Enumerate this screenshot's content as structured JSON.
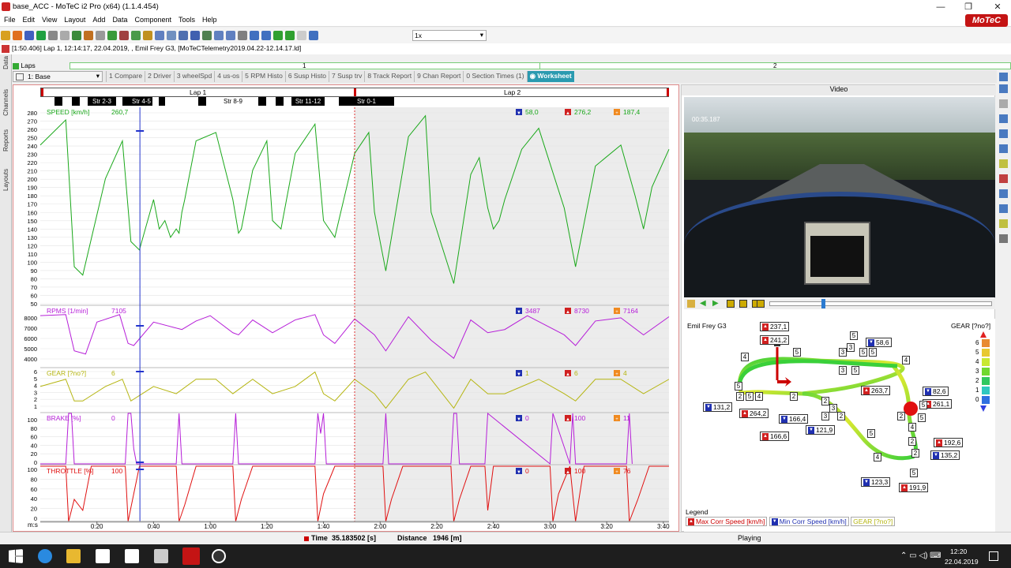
{
  "window": {
    "title": "base_ACC - MoTeC i2 Pro (x64) (1.1.4.454)",
    "logo": "MoTeC"
  },
  "menu": [
    "File",
    "Edit",
    "View",
    "Layout",
    "Add",
    "Data",
    "Component",
    "Tools",
    "Help"
  ],
  "toolbar": {
    "zoom_value": "1x"
  },
  "info": {
    "text": "[1:50.406] Lap 1, 12:14:17, 22.04.2019, , Emil Frey G3, [MoTeCTelemetry2019.04.22-12.14.17.ld]"
  },
  "laps": {
    "label": "Laps",
    "lap1": "1",
    "lap2": "2"
  },
  "sidebar": {
    "data": "Data",
    "channels": "Channels",
    "reports": "Reports",
    "layouts": "Layouts"
  },
  "tabs": {
    "workbook": "1: Base",
    "items": [
      "1 Compare",
      "2 Driver",
      "3 wheelSpd",
      "4 us-os",
      "5 RPM Histo",
      "6 Susp Histo",
      "7 Susp trv",
      "8 Track Report",
      "9 Chan Report",
      "0 Section Times (1)"
    ],
    "active": "Worksheet"
  },
  "chart": {
    "lap_labels": [
      "Lap 1",
      "Lap 2"
    ],
    "sectors": [
      "Str 2-3",
      "Str 4-5",
      "Str 8-9",
      "Str 11-12",
      "Str 0-1"
    ],
    "x_unit": "m:s",
    "x_ticks": [
      "0:20",
      "0:40",
      "1:00",
      "1:20",
      "1:40",
      "2:00",
      "2:20",
      "2:40",
      "3:00",
      "3:20",
      "3:40"
    ],
    "channels": [
      {
        "name": "SPEED [km/h]",
        "cursor": "260,7",
        "min": "58,0",
        "max": "276,2",
        "avg": "187,4",
        "color": "#1aa81a",
        "ticks": [
          "280",
          "270",
          "260",
          "250",
          "240",
          "230",
          "220",
          "210",
          "200",
          "190",
          "180",
          "170",
          "160",
          "150",
          "140",
          "130",
          "120",
          "110",
          "100",
          "90",
          "80",
          "70",
          "60",
          "50"
        ]
      },
      {
        "name": "RPMS [1/min]",
        "cursor": "7105",
        "min": "3487",
        "max": "8730",
        "avg": "7164",
        "color": "#b61ed8",
        "ticks": [
          "8000",
          "7000",
          "6000",
          "5000",
          "4000"
        ]
      },
      {
        "name": "GEAR [?no?]",
        "cursor": "6",
        "min": "1",
        "max": "6",
        "avg": "4",
        "color": "#b5b510",
        "ticks": [
          "6",
          "5",
          "4",
          "3",
          "2",
          "1"
        ]
      },
      {
        "name": "BRAKE [%]",
        "cursor": "0",
        "min": "0",
        "max": "100",
        "avg": "11",
        "color": "#b61ed8",
        "ticks": [
          "100",
          "80",
          "60",
          "40",
          "20",
          "0"
        ]
      },
      {
        "name": "THROTTLE [%]",
        "cursor": "100",
        "min": "0",
        "max": "100",
        "avg": "76",
        "color": "#e01010",
        "ticks": [
          "100",
          "80",
          "60",
          "40",
          "20",
          "0"
        ]
      }
    ]
  },
  "chart_data": {
    "type": "line",
    "x_unit": "m:s",
    "x_range": [
      0,
      222
    ],
    "series": [
      {
        "name": "SPEED [km/h]",
        "ylim": [
          50,
          285
        ],
        "x": [
          0,
          9,
          12,
          15,
          23,
          29,
          32,
          35,
          40,
          42,
          44,
          46,
          48,
          49,
          50,
          51,
          55,
          62,
          68,
          70,
          71,
          75,
          80,
          82,
          85,
          90,
          97,
          100,
          104,
          111,
          116,
          118,
          122,
          130,
          136,
          138,
          146,
          152,
          155,
          158,
          160,
          162,
          164,
          170,
          176,
          185,
          189,
          196,
          205,
          210,
          213,
          216,
          222
        ],
        "values": [
          240,
          270,
          95,
          85,
          200,
          245,
          125,
          115,
          175,
          140,
          150,
          130,
          140,
          135,
          160,
          175,
          245,
          255,
          175,
          135,
          140,
          210,
          245,
          150,
          140,
          230,
          265,
          150,
          130,
          230,
          255,
          160,
          90,
          250,
          275,
          160,
          75,
          205,
          225,
          165,
          140,
          150,
          175,
          235,
          260,
          165,
          95,
          215,
          240,
          180,
          140,
          190,
          235
        ]
      },
      {
        "name": "RPMS [1/min]",
        "ylim": [
          3000,
          8700
        ],
        "x": [
          0,
          9,
          12,
          16,
          20,
          28,
          31,
          33,
          40,
          50,
          55,
          60,
          68,
          70,
          75,
          82,
          90,
          97,
          100,
          104,
          111,
          118,
          122,
          130,
          138,
          146,
          152,
          158,
          164,
          172,
          185,
          189,
          196,
          205,
          213,
          222
        ],
        "values": [
          7800,
          7900,
          4500,
          4200,
          7200,
          7900,
          5200,
          5000,
          7200,
          6500,
          7300,
          7800,
          6200,
          6000,
          7400,
          6200,
          7400,
          7900,
          6000,
          5200,
          7500,
          6000,
          4500,
          7700,
          5500,
          3800,
          7400,
          6200,
          6500,
          7800,
          6000,
          5000,
          7300,
          7600,
          6000,
          7700
        ]
      },
      {
        "name": "GEAR [?no?]",
        "ylim": [
          0.5,
          6.5
        ],
        "x": [
          0,
          9,
          12,
          15,
          23,
          29,
          32,
          40,
          48,
          55,
          62,
          68,
          75,
          82,
          90,
          97,
          100,
          104,
          111,
          118,
          122,
          130,
          136,
          146,
          152,
          158,
          164,
          176,
          185,
          189,
          196,
          205,
          213,
          222
        ],
        "values": [
          4,
          5,
          2,
          2,
          4,
          5,
          2,
          4,
          3,
          5,
          5,
          3,
          5,
          3,
          4,
          6,
          3,
          2,
          5,
          3,
          1,
          5,
          6,
          1,
          5,
          3,
          3,
          5,
          3,
          2,
          5,
          5,
          3,
          5
        ]
      },
      {
        "name": "BRAKE [%]",
        "ylim": [
          0,
          100
        ],
        "x": [
          0,
          9,
          10,
          11,
          12,
          30,
          31,
          32,
          33,
          34,
          48,
          49,
          50,
          68,
          69,
          70,
          97,
          98,
          99,
          100,
          101,
          121,
          122,
          123,
          145,
          146,
          147,
          148,
          157,
          158,
          180,
          181,
          187,
          188,
          189,
          207,
          208,
          209
        ],
        "values": [
          0,
          0,
          100,
          100,
          0,
          0,
          100,
          100,
          30,
          0,
          0,
          100,
          0,
          0,
          100,
          0,
          0,
          100,
          60,
          100,
          0,
          0,
          100,
          0,
          0,
          100,
          100,
          0,
          0,
          100,
          0,
          100,
          0,
          100,
          0,
          0,
          100,
          0
        ]
      },
      {
        "name": "THROTTLE [%]",
        "ylim": [
          0,
          100
        ],
        "x": [
          0,
          9,
          10,
          12,
          15,
          18,
          30,
          31,
          33,
          35,
          48,
          49,
          51,
          55,
          68,
          69,
          71,
          75,
          97,
          98,
          100,
          104,
          121,
          122,
          124,
          128,
          145,
          146,
          148,
          152,
          157,
          158,
          160,
          180,
          181,
          183,
          187,
          189,
          192,
          207,
          208,
          211,
          215,
          222
        ],
        "values": [
          100,
          100,
          0,
          40,
          20,
          100,
          100,
          0,
          50,
          100,
          100,
          0,
          30,
          100,
          100,
          0,
          40,
          100,
          100,
          0,
          50,
          100,
          100,
          0,
          40,
          100,
          100,
          0,
          40,
          100,
          100,
          20,
          100,
          100,
          0,
          50,
          100,
          0,
          100,
          100,
          0,
          40,
          100,
          100
        ]
      }
    ],
    "cursor_time": "35.183502",
    "cursor_distance": "1946"
  },
  "video": {
    "title": "Video",
    "timecode": "00:35.187",
    "status": "Playing"
  },
  "trackmap": {
    "car": "Emil Frey G3",
    "gear_title": "GEAR [?no?]",
    "gear_scale": [
      "6",
      "5",
      "4",
      "3",
      "2",
      "1",
      "0"
    ],
    "max_labels": [
      "237,1",
      "241,2",
      "263,7",
      "261,1",
      "192,6",
      "191,9",
      "166,6",
      "264,2"
    ],
    "min_labels": [
      "58,6",
      "82,6",
      "131,2",
      "166,4",
      "121,9",
      "135,2",
      "123,3"
    ],
    "gear_markers": [
      "4",
      "5",
      "5",
      "3",
      "3",
      "5",
      "5",
      "3",
      "5",
      "4",
      "5",
      "2",
      "5",
      "4",
      "2",
      "2",
      "3",
      "3",
      "2",
      "5",
      "4",
      "2",
      "4",
      "5",
      "5",
      "2",
      "2",
      "5"
    ],
    "legend_title": "Legend",
    "legend": [
      "Max Corr Speed [km/h]",
      "Min Corr Speed [km/h]",
      "GEAR [?no?]"
    ]
  },
  "status": {
    "time_label": "Time",
    "time_value": "35.183502 [s]",
    "distance_label": "Distance",
    "distance_value": "1946 [m]",
    "playing": "Playing"
  },
  "taskbar": {
    "time": "12:20",
    "date": "22.04.2019"
  },
  "colors": {
    "speed": "#1aa81a",
    "rpm": "#b61ed8",
    "gear": "#b5b510",
    "brake": "#b61ed8",
    "throttle": "#e01010",
    "cursor": "#2233cc",
    "tab_active": "#2a9ab0"
  }
}
